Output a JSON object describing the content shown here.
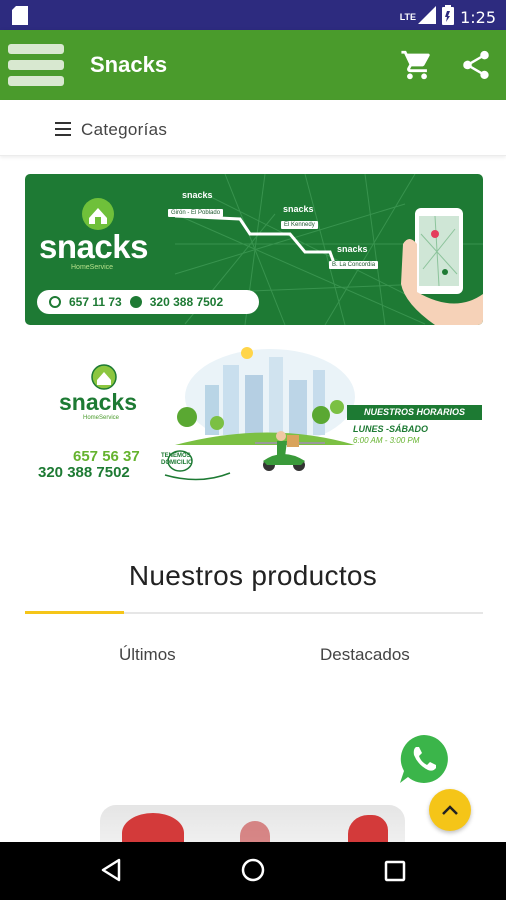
{
  "status_bar": {
    "network": "LTE",
    "time": "1:25"
  },
  "app_bar": {
    "title": "Snacks",
    "icons": [
      "menu-icon",
      "cart-icon",
      "share-icon"
    ]
  },
  "categories": {
    "label": "Categorías"
  },
  "banner_delivery": {
    "brand": "snacks",
    "tagline": "HomeService",
    "phone_landline": "657 11 73",
    "phone_whatsapp": "320 388 7502",
    "map_brand_labels": [
      "snacks",
      "snacks",
      "snacks"
    ],
    "map_locations": [
      "Girón - El Poblado",
      "El Kennedy",
      "B. La Concordia"
    ]
  },
  "banner_hours": {
    "brand": "snacks",
    "tagline": "HomeService",
    "phone_landline": "657 56 37",
    "phone_mobile": "320 388 7502",
    "delivery_note": "TENEMOS DOMICILIO",
    "hours_title": "NUESTROS HORARIOS",
    "days": "LUNES -SÁBADO",
    "time_range": "6:00 AM - 3:00 PM"
  },
  "products": {
    "title": "Nuestros productos",
    "tabs": [
      {
        "label": "Últimos",
        "active": true
      },
      {
        "label": "Destacados",
        "active": false
      }
    ]
  },
  "colors": {
    "status_bar": "#2d2b7f",
    "app_bar": "#4a9b2c",
    "brand_dark_green": "#1e7a34",
    "accent_yellow": "#f5c518",
    "whatsapp_green": "#3bb54a"
  }
}
